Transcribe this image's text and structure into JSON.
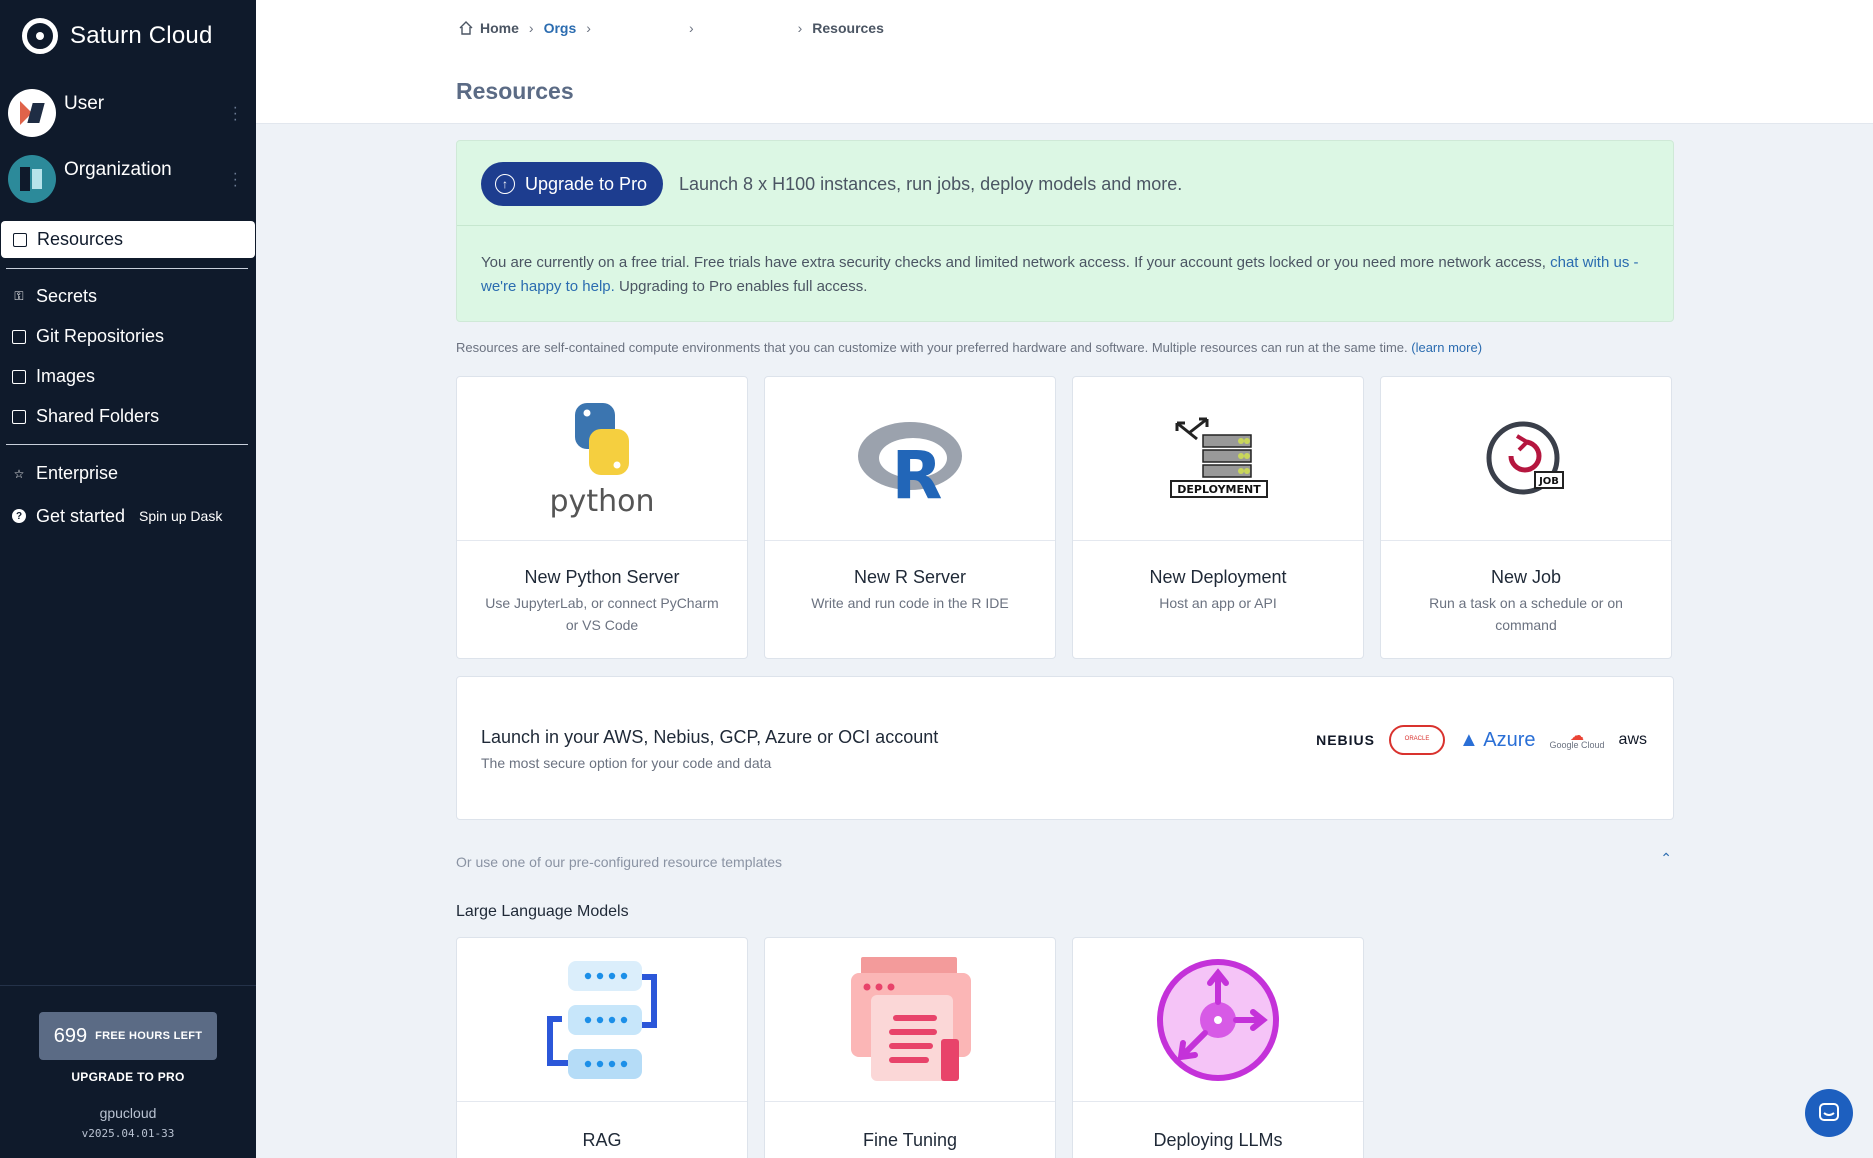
{
  "brand": {
    "name": "Saturn Cloud"
  },
  "accounts": [
    {
      "name": "User"
    },
    {
      "name": "Organization"
    }
  ],
  "nav": {
    "active": "Resources",
    "items": [
      "Secrets",
      "Git Repositories",
      "Images",
      "Shared Folders"
    ],
    "enterprise": "Enterprise",
    "get_started": "Get started",
    "spin_up": "Spin up Dask"
  },
  "footer": {
    "hours": "699",
    "hours_label": "FREE HOURS LEFT",
    "upgrade": "UPGRADE TO PRO",
    "username": "gpucloud",
    "version": "v2025.04.01-33"
  },
  "breadcrumb": {
    "home": "Home",
    "orgs": "Orgs",
    "current": "Resources"
  },
  "page_title": "Resources",
  "promo": {
    "button": "Upgrade to Pro",
    "tagline": "Launch 8 x H100 instances, run jobs, deploy models and more.",
    "body_pre": "You are currently on a free trial. Free trials have extra security checks and limited network access. If your account gets locked or you need more network access, ",
    "body_link": "chat with us - we're happy to help.",
    "body_post": " Upgrading to Pro enables full access."
  },
  "intro": {
    "text": "Resources are self-contained compute environments that you can customize with your preferred hardware and software. Multiple resources can run at the same time. ",
    "link": "(learn more)"
  },
  "resource_cards": [
    {
      "title": "New Python Server",
      "desc": "Use JupyterLab, or connect PyCharm or VS Code",
      "icon": "python-logo",
      "logo_text": "python"
    },
    {
      "title": "New R Server",
      "desc": "Write and run code in the R IDE",
      "icon": "r-logo",
      "logo_text": "R"
    },
    {
      "title": "New Deployment",
      "desc": "Host an app or API",
      "icon": "deployment-icon",
      "logo_text": "DEPLOYMENT"
    },
    {
      "title": "New Job",
      "desc": "Run a task on a schedule or on command",
      "icon": "job-icon",
      "logo_text": "JOB"
    }
  ],
  "cloud": {
    "title": "Launch in your AWS, Nebius, GCP, Azure or OCI account",
    "subtitle": "The most secure option for your code and data",
    "logos": [
      "NEBIUS",
      "ORACLE",
      "Azure",
      "Google Cloud",
      "aws"
    ]
  },
  "templates": {
    "label": "Or use one of our pre-configured resource templates",
    "section": "Large Language Models",
    "cards": [
      {
        "title": "RAG",
        "icon": "rag-icon"
      },
      {
        "title": "Fine Tuning",
        "icon": "fine-tuning-icon"
      },
      {
        "title": "Deploying LLMs",
        "icon": "deploying-llms-icon"
      }
    ]
  },
  "colors": {
    "sidebar": "#0f1a2b",
    "accent": "#1d3d8f",
    "promo_bg": "#dcf7e4",
    "link": "#2b6cb0"
  }
}
